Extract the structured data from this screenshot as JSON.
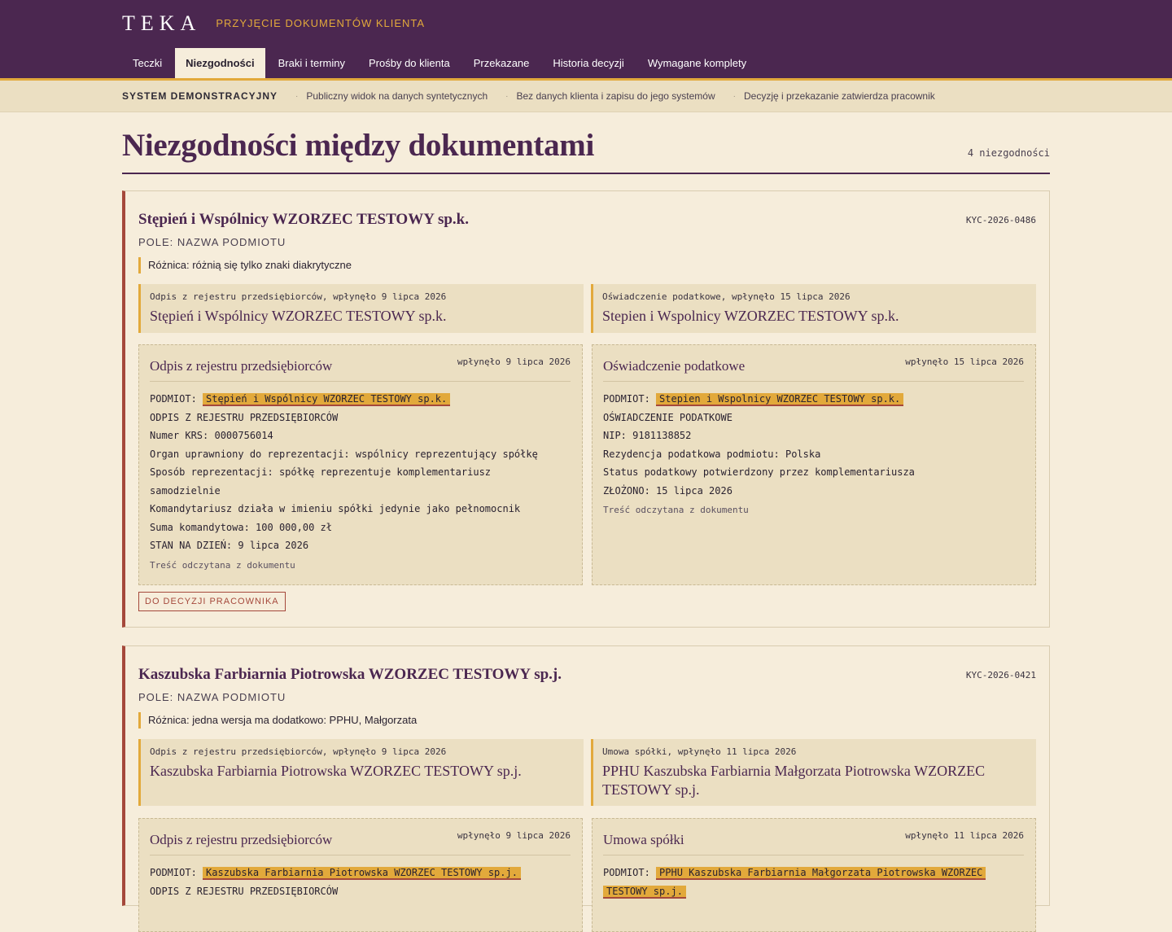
{
  "header": {
    "logo": "TEKA",
    "subtitle": "PRZYJĘCIE DOKUMENTÓW KLIENTA",
    "tabs": [
      "Teczki",
      "Niezgodności",
      "Braki i terminy",
      "Prośby do klienta",
      "Przekazane",
      "Historia decyzji",
      "Wymagane komplety"
    ],
    "active_tab": "Niezgodności"
  },
  "infobar": {
    "system": "SYSTEM DEMONSTRACYJNY",
    "items": [
      "Publiczny widok na danych syntetycznych",
      "Bez danych klienta i zapisu do jego systemów",
      "Decyzję i przekazanie zatwierdza pracownik"
    ]
  },
  "page": {
    "title": "Niezgodności między dokumentami",
    "count": "4 niezgodności"
  },
  "cards": [
    {
      "title": "Stępień i Wspólnicy WZORZEC TESTOWY sp.k.",
      "id": "KYC-2026-0486",
      "field": "POLE: NAZWA PODMIOTU",
      "diff": "Różnica: różnią się tylko znaki diakrytyczne",
      "left_quote": {
        "source": "Odpis z rejestru przedsiębiorców, wpłynęło 9 lipca 2026",
        "value": "Stępień i Wspólnicy WZORZEC TESTOWY sp.k."
      },
      "right_quote": {
        "source": "Oświadczenie podatkowe, wpłynęło 15 lipca 2026",
        "value": "Stepien i Wspolnicy WZORZEC TESTOWY sp.k."
      },
      "left_doc": {
        "title": "Odpis z rejestru przedsiębiorców",
        "date": "wpłynęło 9 lipca 2026",
        "subject_label": "PODMIOT: ",
        "subject": "Stępień i Wspólnicy WZORZEC TESTOWY sp.k.",
        "lines": [
          "ODPIS Z REJESTRU PRZEDSIĘBIORCÓW",
          "Numer KRS: 0000756014",
          "Organ uprawniony do reprezentacji: wspólnicy reprezentujący spółkę",
          "Sposób reprezentacji: spółkę reprezentuje komplementariusz",
          "samodzielnie",
          "Komandytariusz działa w imieniu spółki jedynie jako pełnomocnik",
          "Suma komandytowa: 100 000,00 zł",
          "STAN NA DZIEŃ: 9 lipca 2026"
        ],
        "footer": "Treść odczytana z dokumentu"
      },
      "right_doc": {
        "title": "Oświadczenie podatkowe",
        "date": "wpłynęło 15 lipca 2026",
        "subject_label": "PODMIOT: ",
        "subject": "Stepien i Wspolnicy WZORZEC TESTOWY sp.k.",
        "lines": [
          "OŚWIADCZENIE PODATKOWE",
          "NIP: 9181138852",
          "Rezydencja podatkowa podmiotu: Polska",
          "Status podatkowy potwierdzony przez komplementariusza",
          "ZŁOŻONO: 15 lipca 2026"
        ],
        "footer": "Treść odczytana z dokumentu"
      },
      "button": "DO DECYZJI PRACOWNIKA"
    },
    {
      "title": "Kaszubska Farbiarnia Piotrowska WZORZEC TESTOWY sp.j.",
      "id": "KYC-2026-0421",
      "field": "POLE: NAZWA PODMIOTU",
      "diff": "Różnica: jedna wersja ma dodatkowo: PPHU, Małgorzata",
      "left_quote": {
        "source": "Odpis z rejestru przedsiębiorców, wpłynęło 9 lipca 2026",
        "value": "Kaszubska Farbiarnia Piotrowska WZORZEC TESTOWY sp.j."
      },
      "right_quote": {
        "source": "Umowa spółki, wpłynęło 11 lipca 2026",
        "value": "PPHU Kaszubska Farbiarnia Małgorzata Piotrowska WZORZEC TESTOWY sp.j."
      },
      "left_doc": {
        "title": "Odpis z rejestru przedsiębiorców",
        "date": "wpłynęło 9 lipca 2026",
        "subject_label": "PODMIOT: ",
        "subject": "Kaszubska Farbiarnia Piotrowska WZORZEC TESTOWY sp.j.",
        "lines": [
          "ODPIS Z REJESTRU PRZEDSIĘBIORCÓW"
        ]
      },
      "right_doc": {
        "title": "Umowa spółki",
        "date": "wpłynęło 11 lipca 2026",
        "subject_label": "PODMIOT: ",
        "subject": "PPHU Kaszubska Farbiarnia Małgorzata Piotrowska WZORZEC",
        "subject_cont": "TESTOWY sp.j.",
        "lines": []
      }
    }
  ]
}
